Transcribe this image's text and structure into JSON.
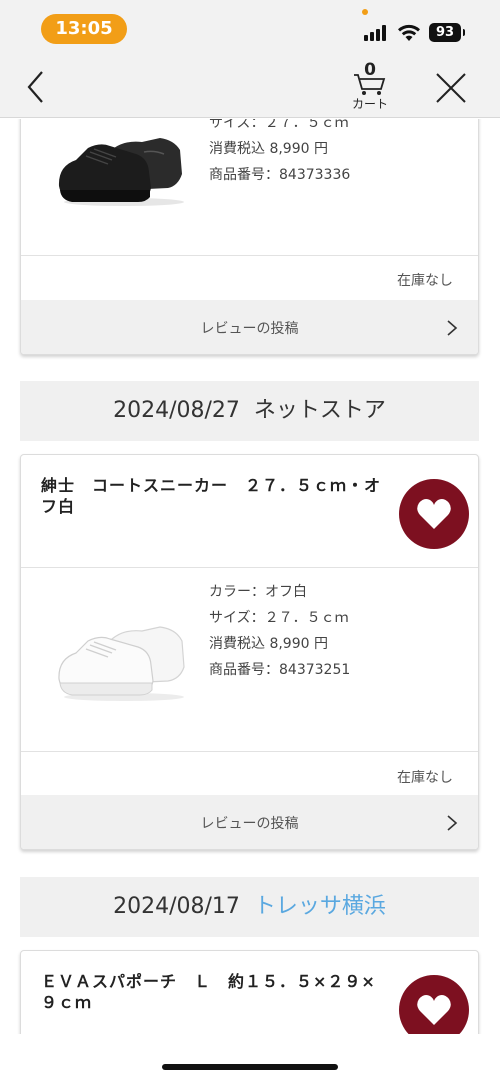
{
  "status_bar": {
    "time": "13:05",
    "battery": "93"
  },
  "nav": {
    "cart_count": "0",
    "cart_label": "カート"
  },
  "top_item": {
    "specs": [
      "サイズ：２７．５ｃｍ",
      "消費税込 8,990 円",
      "商品番号：84373336"
    ],
    "stock": "在庫なし",
    "review": "レビューの投稿"
  },
  "order2": {
    "date": "2024/08/27",
    "store": "ネットストア",
    "item": {
      "name": "紳士　コートスニーカー　２７．５ｃｍ・オフ白",
      "specs": [
        "カラー：オフ白",
        "サイズ：２７．５ｃｍ",
        "消費税込 8,990 円",
        "商品番号：84373251"
      ],
      "stock": "在庫なし",
      "review": "レビューの投稿"
    }
  },
  "order3": {
    "date": "2024/08/17",
    "store": "トレッサ横浜",
    "item": {
      "name": "ＥＶＡスパポーチ　Ｌ　約１５．５×２９×９ｃｍ"
    }
  },
  "colors": {
    "accent": "#f29e17",
    "favorite": "#7d1020",
    "link": "#5aa8e0"
  },
  "icons": [
    "back-chevron-icon",
    "cart-icon",
    "close-icon",
    "heart-icon",
    "chevron-right-icon"
  ]
}
